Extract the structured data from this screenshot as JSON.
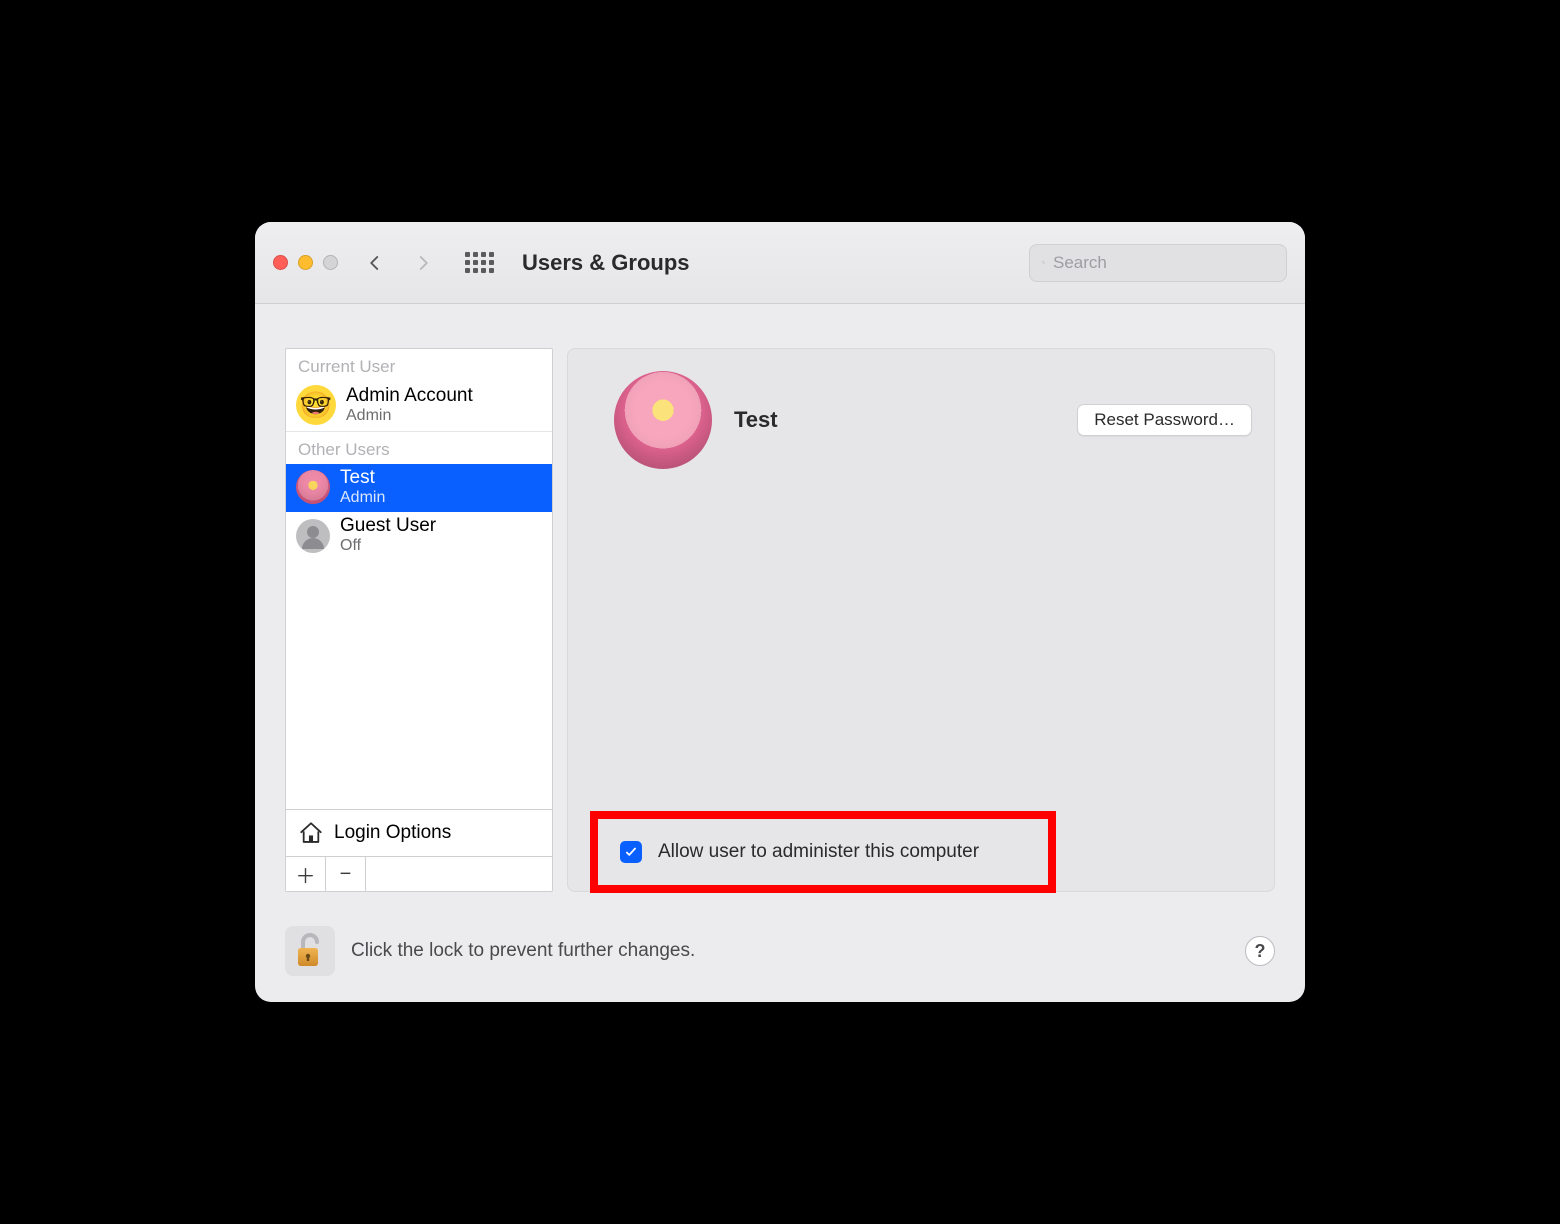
{
  "window": {
    "title": "Users & Groups"
  },
  "search": {
    "placeholder": "Search"
  },
  "sidebar": {
    "current_user_label": "Current User",
    "other_users_label": "Other Users",
    "current_user": {
      "name": "Admin Account",
      "role": "Admin"
    },
    "other_users": [
      {
        "name": "Test",
        "role": "Admin",
        "selected": true,
        "avatar": "flower"
      },
      {
        "name": "Guest User",
        "role": "Off",
        "selected": false,
        "avatar": "grey"
      }
    ],
    "login_options_label": "Login Options"
  },
  "detail": {
    "username": "Test",
    "reset_password_label": "Reset Password…",
    "admin_checkbox_label": "Allow user to administer this computer",
    "admin_checkbox_checked": true
  },
  "footer": {
    "lock_text": "Click the lock to prevent further changes."
  }
}
